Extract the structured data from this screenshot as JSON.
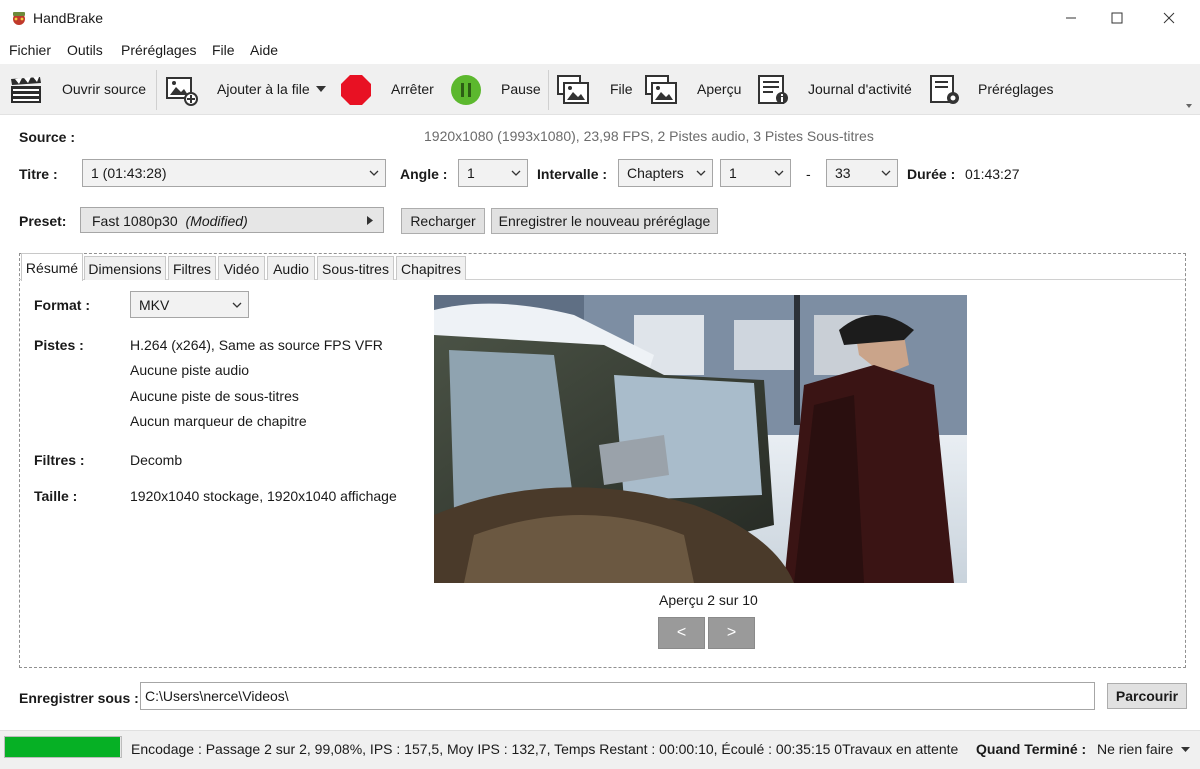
{
  "window": {
    "title": "HandBrake"
  },
  "menu": [
    "Fichier",
    "Outils",
    "Préréglages",
    "File",
    "Aide"
  ],
  "toolbar": {
    "open_source": "Ouvrir source",
    "add_to_queue": "Ajouter à la file",
    "stop": "Arrêter",
    "pause": "Pause",
    "queue": "File",
    "preview": "Aperçu",
    "activity_log": "Journal d'activité",
    "presets": "Préréglages"
  },
  "source": {
    "label": "Source :",
    "info": "1920x1080 (1993x1080), 23,98 FPS, 2 Pistes audio, 3 Pistes Sous-titres"
  },
  "title_row": {
    "title_label": "Titre :",
    "title_value": "1  (01:43:28)",
    "angle_label": "Angle :",
    "angle_value": "1",
    "range_label": "Intervalle :",
    "range_type": "Chapters",
    "range_start": "1",
    "range_dash": "-",
    "range_end": "33",
    "duration_label": "Durée :",
    "duration_value": "01:43:27"
  },
  "preset": {
    "label": "Preset:",
    "name": "Fast 1080p30",
    "modified": "(Modified)",
    "reload": "Recharger",
    "save_new": "Enregistrer le nouveau préréglage"
  },
  "tabs": [
    "Résumé",
    "Dimensions",
    "Filtres",
    "Vidéo",
    "Audio",
    "Sous-titres",
    "Chapitres"
  ],
  "summary": {
    "format_label": "Format :",
    "format_value": "MKV",
    "tracks_label": "Pistes :",
    "tracks": [
      "H.264 (x264), Same as source FPS VFR",
      "Aucune piste audio",
      "Aucune piste de sous-titres",
      "Aucun marqueur de chapitre"
    ],
    "filters_label": "Filtres :",
    "filters_value": "Decomb",
    "size_label": "Taille :",
    "size_value": "1920x1040 stockage, 1920x1040 affichage",
    "preview_caption": "Aperçu 2 sur 10",
    "prev": "<",
    "next": ">"
  },
  "save_as": {
    "label": "Enregistrer sous :",
    "path": "C:\\Users\\nerce\\Videos\\",
    "browse": "Parcourir"
  },
  "status": {
    "progress": 0.9908,
    "text": "Encodage : Passage 2 sur 2,  99,08%, IPS :  157,5, Moy IPS :  132,7,  Temps Restant : 00:00:10, Écoulé : 00:35:15 0Travaux en attente",
    "when_done_label": "Quand Terminé :",
    "when_done_value": "Ne rien faire"
  },
  "colors": {
    "progress": "#06b025",
    "stop": "#e81123",
    "pause": "#5cb82e"
  }
}
